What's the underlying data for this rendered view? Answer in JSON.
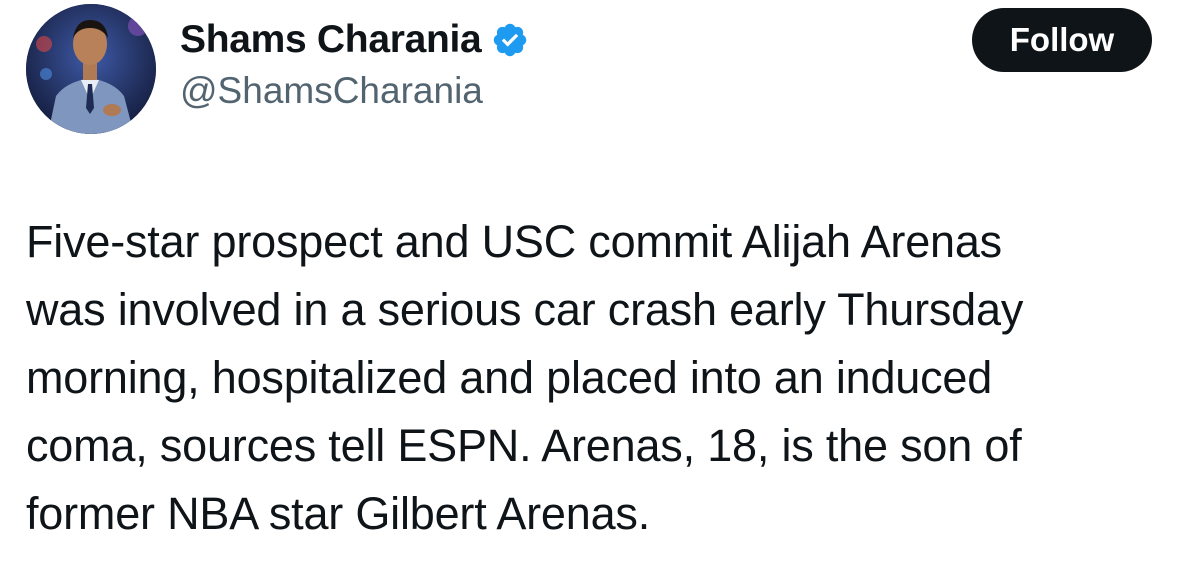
{
  "author": {
    "display_name": "Shams Charania",
    "handle": "@ShamsCharania",
    "verified": true,
    "verified_color": "#1d9bf0"
  },
  "follow_button": {
    "label": "Follow"
  },
  "tweet": {
    "lines": [
      "Five-star prospect and USC commit Alijah Arenas",
      "was involved in a serious car crash early Thursday",
      "morning, hospitalized and placed into an induced",
      "coma, sources tell ESPN. Arenas, 18, is the son of",
      "former NBA star Gilbert Arenas."
    ]
  },
  "icons": {
    "avatar": "profile-photo",
    "verified": "verified-badge-icon"
  }
}
